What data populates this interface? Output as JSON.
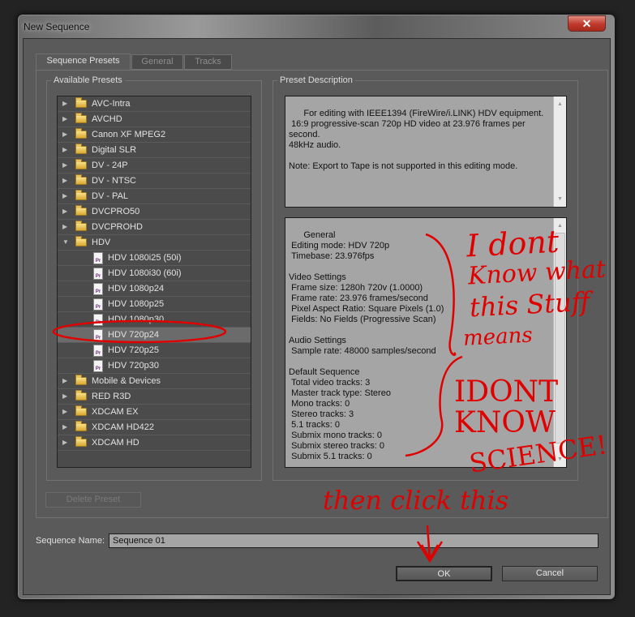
{
  "window": {
    "title": "New Sequence",
    "close_icon": "close-icon"
  },
  "tabs": [
    {
      "label": "Sequence Presets",
      "active": true
    },
    {
      "label": "General",
      "active": false
    },
    {
      "label": "Tracks",
      "active": false
    }
  ],
  "presets": {
    "label": "Available Presets",
    "items": [
      {
        "label": "AVC-Intra",
        "type": "folder",
        "expanded": false
      },
      {
        "label": "AVCHD",
        "type": "folder",
        "expanded": false
      },
      {
        "label": "Canon XF MPEG2",
        "type": "folder",
        "expanded": false
      },
      {
        "label": "Digital SLR",
        "type": "folder",
        "expanded": false
      },
      {
        "label": "DV - 24P",
        "type": "folder",
        "expanded": false
      },
      {
        "label": "DV - NTSC",
        "type": "folder",
        "expanded": false
      },
      {
        "label": "DV - PAL",
        "type": "folder",
        "expanded": false
      },
      {
        "label": "DVCPRO50",
        "type": "folder",
        "expanded": false
      },
      {
        "label": "DVCPROHD",
        "type": "folder",
        "expanded": false
      },
      {
        "label": "HDV",
        "type": "folder",
        "expanded": true
      },
      {
        "label": "HDV 1080i25 (50i)",
        "type": "preset"
      },
      {
        "label": "HDV 1080i30 (60i)",
        "type": "preset"
      },
      {
        "label": "HDV 1080p24",
        "type": "preset"
      },
      {
        "label": "HDV 1080p25",
        "type": "preset"
      },
      {
        "label": "HDV 1080p30",
        "type": "preset"
      },
      {
        "label": "HDV 720p24",
        "type": "preset",
        "selected": true
      },
      {
        "label": "HDV 720p25",
        "type": "preset"
      },
      {
        "label": "HDV 720p30",
        "type": "preset"
      },
      {
        "label": "Mobile & Devices",
        "type": "folder",
        "expanded": false
      },
      {
        "label": "RED R3D",
        "type": "folder",
        "expanded": false
      },
      {
        "label": "XDCAM EX",
        "type": "folder",
        "expanded": false
      },
      {
        "label": "XDCAM HD422",
        "type": "folder",
        "expanded": false
      },
      {
        "label": "XDCAM HD",
        "type": "folder",
        "expanded": false
      }
    ],
    "delete_button": "Delete Preset"
  },
  "description": {
    "label": "Preset Description",
    "text": "For editing with IEEE1394 (FireWire/i.LINK) HDV equipment.\n 16:9 progressive-scan 720p HD video at 23.976 frames per\nsecond.\n48kHz audio.\n\nNote: Export to Tape is not supported in this editing mode.",
    "details": "General\n Editing mode: HDV 720p\n Timebase: 23.976fps\n\nVideo Settings\n Frame size: 1280h 720v (1.0000)\n Frame rate: 23.976 frames/second\n Pixel Aspect Ratio: Square Pixels (1.0)\n Fields: No Fields (Progressive Scan)\n\nAudio Settings\n Sample rate: 48000 samples/second\n\nDefault Sequence\n Total video tracks: 3\n Master track type: Stereo\n Mono tracks: 0\n Stereo tracks: 3\n 5.1 tracks: 0\n Submix mono tracks: 0\n Submix stereo tracks: 0\n Submix 5.1 tracks: 0"
  },
  "sequence_name": {
    "label": "Sequence Name:",
    "value": "Sequence 01"
  },
  "buttons": {
    "ok": "OK",
    "cancel": "Cancel"
  },
  "annotations": {
    "note1": [
      "I dont",
      "Know what",
      "this Stuff",
      "means"
    ],
    "note2": [
      "IDONT",
      "KNOW",
      "SCIENCE!"
    ],
    "note3": "then click this",
    "ink_color": "#e00000"
  }
}
